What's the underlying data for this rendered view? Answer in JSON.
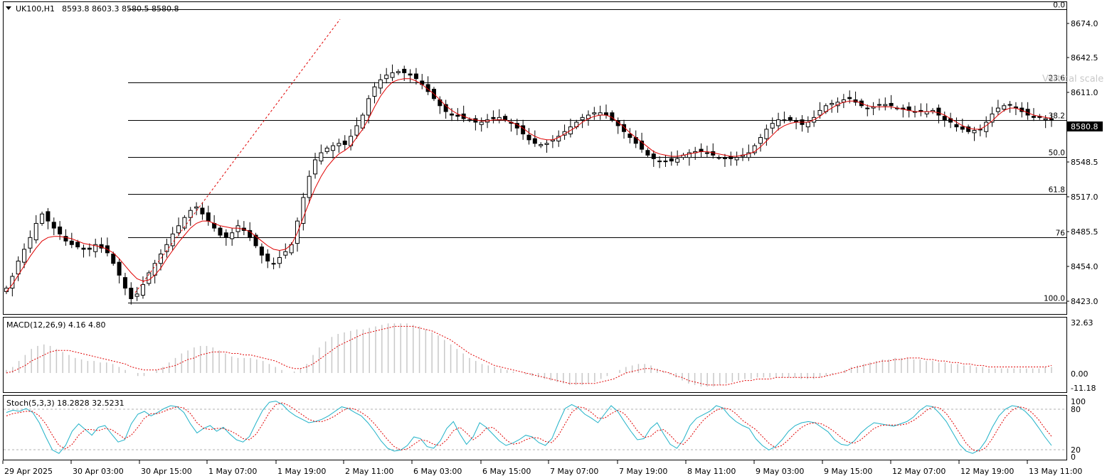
{
  "main": {
    "header": {
      "symbol": "UK100,H1",
      "ohlc": "8593.8 8603.3 8580.5 8580.8"
    },
    "price_ticks": [
      "8674.0",
      "8642.5",
      "8611.0",
      "8580.8",
      "8548.5",
      "8517.0",
      "8485.5",
      "8454.0",
      "8423.0"
    ],
    "current_price": "8580.8",
    "fib_levels": [
      {
        "label": "0.0",
        "price": 8674.0
      },
      {
        "label": "23.6",
        "price": 8611.7
      },
      {
        "label": "38.2",
        "price": 8580.0
      },
      {
        "label": "50.0",
        "price": 8548.5
      },
      {
        "label": "61.8",
        "price": 8517.3
      },
      {
        "label": "76",
        "price": 8480.0
      },
      {
        "label": "100.0",
        "price": 8424.7
      }
    ],
    "watermark": "Vertical scale"
  },
  "macd": {
    "label": "MACD(12,26,9) 4.16 4.80",
    "ticks": [
      "32.63",
      "0.00",
      "-11.18"
    ]
  },
  "stoch": {
    "label": "Stoch(5,3,3) 18.2828 32.5231",
    "ticks": [
      "100",
      "80",
      "20",
      "0"
    ]
  },
  "time_axis": [
    "29 Apr 2025",
    "30 Apr 03:00",
    "30 Apr 15:00",
    "1 May 07:00",
    "1 May 19:00",
    "2 May 11:00",
    "6 May 03:00",
    "6 May 15:00",
    "7 May 07:00",
    "7 May 19:00",
    "8 May 11:00",
    "9 May 03:00",
    "9 May 15:00",
    "12 May 07:00",
    "12 May 19:00",
    "13 May 11:00"
  ],
  "colors": {
    "ma": "#e00000",
    "signal": "#e00000",
    "stoch_main": "#20b2c8",
    "stoch_signal": "#e00000",
    "hist": "#c8c8c8",
    "bull": "#ffffff",
    "bear": "#000000",
    "grid": "#000000"
  },
  "chart_data": {
    "type": "candlestick",
    "timeframe": "H1",
    "ylim": [
      8415,
      8680
    ],
    "close_series": [
      8437,
      8447,
      8460,
      8470,
      8480,
      8492,
      8500,
      8494,
      8488,
      8483,
      8477,
      8474,
      8472,
      8470,
      8470,
      8474,
      8471,
      8467,
      8458,
      8448,
      8437,
      8428,
      8432,
      8440,
      8450,
      8458,
      8466,
      8474,
      8483,
      8490,
      8497,
      8503,
      8506,
      8500,
      8494,
      8488,
      8482,
      8480,
      8484,
      8490,
      8486,
      8480,
      8473,
      8465,
      8460,
      8458,
      8463,
      8468,
      8474,
      8494,
      8514,
      8532,
      8546,
      8552,
      8556,
      8558,
      8560,
      8559,
      8566,
      8575,
      8584,
      8598,
      8608,
      8614,
      8618,
      8620,
      8621,
      8620,
      8618,
      8615,
      8610,
      8604,
      8598,
      8592,
      8587,
      8584,
      8583,
      8581,
      8580,
      8578,
      8578,
      8580,
      8581,
      8582,
      8580,
      8577,
      8573,
      8568,
      8563,
      8560,
      8559,
      8560,
      8563,
      8566,
      8570,
      8574,
      8578,
      8582,
      8584,
      8586,
      8586,
      8584,
      8580,
      8575,
      8570,
      8565,
      8560,
      8555,
      8550,
      8547,
      8545,
      8545,
      8545,
      8547,
      8550,
      8552,
      8553,
      8553,
      8552,
      8550,
      8548,
      8547,
      8547,
      8548,
      8550,
      8552,
      8558,
      8565,
      8572,
      8577,
      8580,
      8580,
      8580,
      8579,
      8576,
      8578,
      8582,
      8588,
      8592,
      8594,
      8595,
      8597,
      8598,
      8595,
      8592,
      8590,
      8591,
      8593,
      8593,
      8592,
      8590,
      8589,
      8588,
      8587,
      8587,
      8587,
      8588,
      8584,
      8580,
      8578,
      8574,
      8572,
      8570,
      8571,
      8572,
      8578,
      8585,
      8590,
      8592,
      8593,
      8590,
      8587,
      8584,
      8582,
      8582,
      8581,
      8580
    ],
    "ma_series": [
      8434,
      8440,
      8448,
      8456,
      8464,
      8471,
      8477,
      8480,
      8481,
      8481,
      8480,
      8479,
      8477,
      8475,
      8474,
      8473,
      8472,
      8470,
      8467,
      8462,
      8456,
      8450,
      8445,
      8443,
      8444,
      8448,
      8454,
      8462,
      8469,
      8476,
      8482,
      8488,
      8492,
      8494,
      8494,
      8492,
      8490,
      8489,
      8488,
      8488,
      8487,
      8485,
      8481,
      8477,
      8473,
      8470,
      8469,
      8470,
      8474,
      8484,
      8497,
      8510,
      8522,
      8532,
      8540,
      8546,
      8551,
      8554,
      8558,
      8565,
      8572,
      8581,
      8591,
      8600,
      8607,
      8612,
      8614,
      8615,
      8615,
      8613,
      8610,
      8606,
      8602,
      8597,
      8592,
      8588,
      8585,
      8583,
      8581,
      8580,
      8579,
      8579,
      8580,
      8580,
      8580,
      8578,
      8576,
      8573,
      8569,
      8566,
      8564,
      8563,
      8563,
      8565,
      8568,
      8571,
      8574,
      8578,
      8581,
      8583,
      8584,
      8584,
      8582,
      8578,
      8574,
      8569,
      8565,
      8561,
      8557,
      8553,
      8551,
      8550,
      8549,
      8549,
      8550,
      8551,
      8552,
      8553,
      8553,
      8552,
      8551,
      8550,
      8549,
      8549,
      8550,
      8551,
      8553,
      8557,
      8562,
      8567,
      8572,
      8575,
      8577,
      8578,
      8578,
      8578,
      8580,
      8583,
      8587,
      8590,
      8593,
      8595,
      8596,
      8596,
      8594,
      8592,
      8591,
      8591,
      8591,
      8591,
      8590,
      8589,
      8588,
      8587,
      8587,
      8587,
      8587,
      8586,
      8584,
      8581,
      8578,
      8575,
      8573,
      8572,
      8572,
      8575,
      8579,
      8584,
      8588,
      8590,
      8590,
      8588,
      8586,
      8584,
      8583,
      8582,
      8581
    ],
    "macd_hist": [
      2,
      4,
      8,
      12,
      16,
      18,
      19,
      18,
      16,
      14,
      12,
      10,
      9,
      8,
      8,
      7,
      7,
      6,
      4,
      2,
      0,
      -2,
      -2,
      0,
      2,
      4,
      7,
      10,
      13,
      15,
      17,
      18,
      18,
      17,
      15,
      13,
      11,
      10,
      10,
      10,
      9,
      8,
      6,
      4,
      2,
      0,
      1,
      3,
      6,
      12,
      17,
      21,
      24,
      26,
      27,
      28,
      29,
      29,
      30,
      31,
      32,
      33,
      33,
      33,
      33,
      32,
      31,
      29,
      27,
      25,
      22,
      19,
      16,
      13,
      10,
      8,
      6,
      5,
      4,
      3,
      2,
      1,
      0,
      -1,
      -2,
      -3,
      -4,
      -5,
      -6,
      -7,
      -8,
      -8,
      -8,
      -7,
      -6,
      -4,
      -2,
      0,
      2,
      4,
      5,
      6,
      6,
      5,
      3,
      1,
      -1,
      -3,
      -5,
      -7,
      -8,
      -9,
      -9,
      -9,
      -8,
      -7,
      -6,
      -5,
      -4,
      -4,
      -3,
      -3,
      -3,
      -3,
      -3,
      -3,
      -3,
      -4,
      -4,
      -4,
      -3,
      -2,
      -1,
      0,
      2,
      4,
      5,
      6,
      7,
      8,
      9,
      9,
      10,
      10,
      10,
      9,
      9,
      8,
      8,
      7,
      7,
      6,
      6,
      5,
      5,
      4,
      4,
      3,
      3,
      3,
      3,
      3,
      3,
      3,
      3,
      3,
      4,
      4
    ],
    "macd_signal": [
      0,
      1,
      3,
      5,
      8,
      10,
      12,
      14,
      15,
      15,
      15,
      14,
      13,
      12,
      11,
      10,
      9,
      8,
      7,
      6,
      4,
      3,
      2,
      2,
      2,
      3,
      4,
      5,
      7,
      9,
      10,
      12,
      13,
      14,
      14,
      14,
      13,
      13,
      12,
      12,
      11,
      10,
      9,
      8,
      6,
      4,
      3,
      3,
      4,
      6,
      9,
      12,
      15,
      18,
      20,
      22,
      24,
      26,
      27,
      28,
      29,
      30,
      31,
      31,
      31,
      31,
      30,
      29,
      28,
      26,
      24,
      22,
      19,
      16,
      13,
      11,
      9,
      7,
      5,
      4,
      3,
      2,
      1,
      0,
      -1,
      -2,
      -3,
      -4,
      -5,
      -6,
      -7,
      -7,
      -7,
      -7,
      -7,
      -6,
      -5,
      -4,
      -2,
      0,
      1,
      2,
      3,
      3,
      2,
      1,
      0,
      -2,
      -3,
      -5,
      -6,
      -7,
      -8,
      -8,
      -8,
      -8,
      -7,
      -6,
      -5,
      -5,
      -4,
      -4,
      -4,
      -3,
      -3,
      -3,
      -3,
      -3,
      -3,
      -3,
      -3,
      -2,
      -1,
      0,
      1,
      3,
      4,
      5,
      6,
      7,
      8,
      8,
      9,
      9,
      10,
      10,
      10,
      9,
      9,
      8,
      8,
      7,
      7,
      6,
      6,
      5,
      5,
      4,
      4,
      4,
      4,
      4,
      4,
      4,
      4,
      4,
      4,
      5
    ],
    "stoch_main": [
      78,
      82,
      80,
      85,
      78,
      60,
      35,
      12,
      6,
      20,
      45,
      58,
      48,
      38,
      52,
      55,
      40,
      26,
      30,
      58,
      75,
      80,
      72,
      78,
      85,
      90,
      88,
      78,
      58,
      42,
      50,
      55,
      45,
      52,
      40,
      30,
      26,
      36,
      60,
      82,
      96,
      98,
      92,
      80,
      72,
      66,
      60,
      62,
      66,
      72,
      80,
      88,
      85,
      78,
      72,
      60,
      45,
      28,
      15,
      10,
      12,
      20,
      35,
      32,
      18,
      15,
      28,
      50,
      62,
      40,
      22,
      35,
      60,
      52,
      40,
      28,
      20,
      24,
      30,
      38,
      35,
      25,
      20,
      32,
      60,
      85,
      92,
      86,
      75,
      68,
      60,
      75,
      90,
      80,
      62,
      45,
      30,
      32,
      50,
      60,
      40,
      22,
      15,
      30,
      55,
      68,
      74,
      80,
      90,
      86,
      72,
      62,
      55,
      50,
      32,
      20,
      12,
      18,
      30,
      45,
      55,
      60,
      62,
      60,
      52,
      44,
      30,
      22,
      20,
      28,
      42,
      52,
      60,
      58,
      56,
      54,
      58,
      62,
      70,
      82,
      90,
      88,
      76,
      62,
      42,
      22,
      10,
      6,
      12,
      28,
      52,
      72,
      84,
      90,
      88,
      80,
      68,
      52,
      35,
      20
    ],
    "stoch_signal": [
      72,
      76,
      78,
      80,
      80,
      72,
      58,
      38,
      20,
      14,
      22,
      38,
      48,
      48,
      46,
      50,
      48,
      40,
      32,
      38,
      52,
      68,
      76,
      76,
      80,
      85,
      88,
      86,
      76,
      60,
      50,
      48,
      50,
      50,
      46,
      40,
      32,
      30,
      40,
      58,
      78,
      92,
      95,
      90,
      82,
      74,
      66,
      62,
      62,
      66,
      72,
      80,
      86,
      84,
      78,
      70,
      58,
      44,
      30,
      18,
      12,
      14,
      22,
      30,
      28,
      22,
      20,
      30,
      46,
      52,
      42,
      30,
      38,
      50,
      52,
      42,
      30,
      22,
      24,
      30,
      34,
      33,
      27,
      25,
      38,
      58,
      78,
      88,
      86,
      78,
      68,
      68,
      76,
      82,
      76,
      62,
      46,
      34,
      36,
      46,
      48,
      38,
      25,
      22,
      34,
      50,
      64,
      74,
      82,
      86,
      84,
      76,
      64,
      56,
      48,
      36,
      24,
      16,
      20,
      30,
      42,
      52,
      58,
      60,
      58,
      52,
      44,
      34,
      26,
      24,
      30,
      40,
      50,
      55,
      56,
      56,
      56,
      58,
      64,
      72,
      82,
      88,
      86,
      76,
      60,
      42,
      24,
      12,
      10,
      16,
      32,
      52,
      70,
      82,
      88,
      86,
      78,
      66,
      50,
      36
    ]
  }
}
